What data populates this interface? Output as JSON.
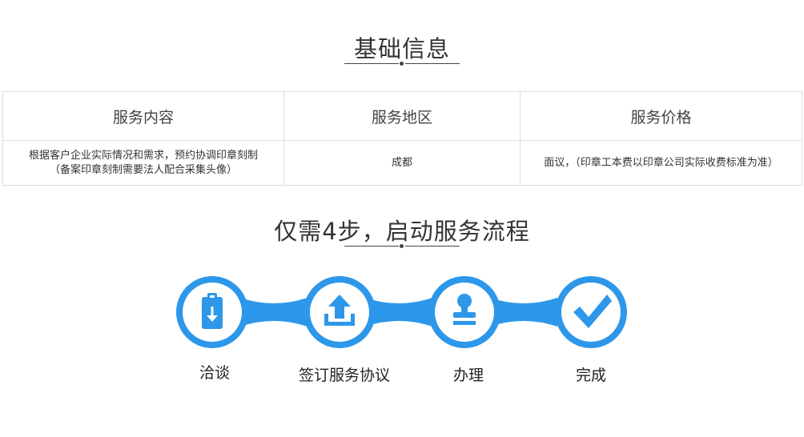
{
  "basic_info": {
    "title": "基础信息",
    "headers": [
      "服务内容",
      "服务地区",
      "服务价格"
    ],
    "row": {
      "content_line1": "根据客户企业实际情况和需求，预约协调印章刻制",
      "content_line2": "（备案印章刻制需要法人配合采集头像）",
      "region": "成都",
      "price": "面议，（印章工本费以印章公司实际收费标准为准）"
    }
  },
  "process": {
    "title": "仅需4步，启动服务流程",
    "steps": [
      {
        "label": "洽谈",
        "icon": "clipboard-download-icon"
      },
      {
        "label": "签订服务协议",
        "icon": "upload-icon"
      },
      {
        "label": "办理",
        "icon": "stamp-icon"
      },
      {
        "label": "完成",
        "icon": "checkmark-icon"
      }
    ]
  },
  "colors": {
    "accent_blue": "#2d97ea",
    "text": "#333333",
    "border": "#dcdcdc"
  }
}
